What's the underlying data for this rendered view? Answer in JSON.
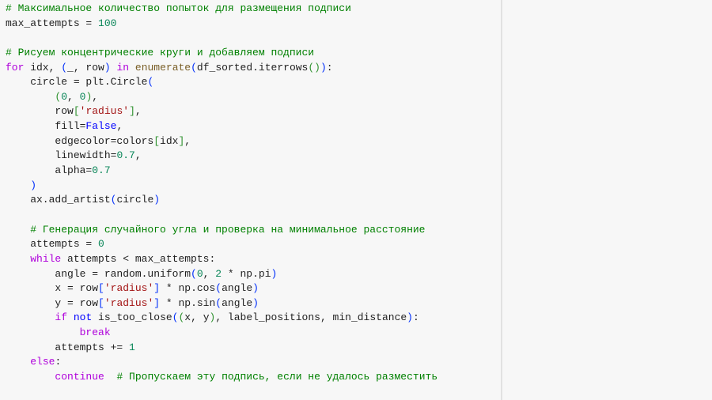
{
  "code_lines": [
    [
      [
        "# Максимальное количество попыток для размещения подписи",
        "c"
      ]
    ],
    [
      [
        "max_attempts = ",
        ""
      ],
      [
        "100",
        "n"
      ]
    ],
    [],
    [
      [
        "# Рисуем концентрические круги и добавляем подписи",
        "c"
      ]
    ],
    [
      [
        "for",
        "k"
      ],
      [
        " idx, ",
        ""
      ],
      [
        "(",
        "b1"
      ],
      [
        "_, row",
        ""
      ],
      [
        ")",
        "b1"
      ],
      [
        " ",
        ""
      ],
      [
        "in",
        "k"
      ],
      [
        " ",
        ""
      ],
      [
        "enumerate",
        "f"
      ],
      [
        "(",
        "b1"
      ],
      [
        "df_sorted.iterrows",
        ""
      ],
      [
        "()",
        "b2"
      ],
      [
        ")",
        "b1"
      ],
      [
        ":",
        ""
      ]
    ],
    [
      [
        "    circle = plt.Circle",
        ""
      ],
      [
        "(",
        "b1"
      ]
    ],
    [
      [
        "        ",
        ""
      ],
      [
        "(",
        "b2"
      ],
      [
        "0",
        "n"
      ],
      [
        ", ",
        ""
      ],
      [
        "0",
        "n"
      ],
      [
        ")",
        "b2"
      ],
      [
        ",",
        ""
      ]
    ],
    [
      [
        "        row",
        ""
      ],
      [
        "[",
        "b2"
      ],
      [
        "'radius'",
        "s"
      ],
      [
        "]",
        "b2"
      ],
      [
        ",",
        ""
      ]
    ],
    [
      [
        "        fill=",
        ""
      ],
      [
        "False",
        "kb"
      ],
      [
        ",",
        ""
      ]
    ],
    [
      [
        "        edgecolor=colors",
        ""
      ],
      [
        "[",
        "b2"
      ],
      [
        "idx",
        ""
      ],
      [
        "]",
        "b2"
      ],
      [
        ",",
        ""
      ]
    ],
    [
      [
        "        linewidth=",
        ""
      ],
      [
        "0.7",
        "n"
      ],
      [
        ",",
        ""
      ]
    ],
    [
      [
        "        alpha=",
        ""
      ],
      [
        "0.7",
        "n"
      ]
    ],
    [
      [
        "    ",
        ""
      ],
      [
        ")",
        "b1"
      ]
    ],
    [
      [
        "    ax.add_artist",
        ""
      ],
      [
        "(",
        "b1"
      ],
      [
        "circle",
        ""
      ],
      [
        ")",
        "b1"
      ]
    ],
    [],
    [
      [
        "    # Генерация случайного угла и проверка на минимальное расстояние",
        "c"
      ]
    ],
    [
      [
        "    attempts = ",
        ""
      ],
      [
        "0",
        "n"
      ]
    ],
    [
      [
        "    ",
        ""
      ],
      [
        "while",
        "k"
      ],
      [
        " attempts < max_attempts:",
        ""
      ]
    ],
    [
      [
        "        angle = random.uniform",
        ""
      ],
      [
        "(",
        "b1"
      ],
      [
        "0",
        "n"
      ],
      [
        ", ",
        ""
      ],
      [
        "2",
        "n"
      ],
      [
        " * np.pi",
        ""
      ],
      [
        ")",
        "b1"
      ]
    ],
    [
      [
        "        x = row",
        ""
      ],
      [
        "[",
        "b1"
      ],
      [
        "'radius'",
        "s"
      ],
      [
        "]",
        "b1"
      ],
      [
        " * np.cos",
        ""
      ],
      [
        "(",
        "b1"
      ],
      [
        "angle",
        ""
      ],
      [
        ")",
        "b1"
      ]
    ],
    [
      [
        "        y = row",
        ""
      ],
      [
        "[",
        "b1"
      ],
      [
        "'radius'",
        "s"
      ],
      [
        "]",
        "b1"
      ],
      [
        " * np.sin",
        ""
      ],
      [
        "(",
        "b1"
      ],
      [
        "angle",
        ""
      ],
      [
        ")",
        "b1"
      ]
    ],
    [
      [
        "        ",
        ""
      ],
      [
        "if",
        "k"
      ],
      [
        " ",
        ""
      ],
      [
        "not",
        "kb"
      ],
      [
        " is_too_close",
        ""
      ],
      [
        "(",
        "b1"
      ],
      [
        "(",
        "b2"
      ],
      [
        "x, y",
        ""
      ],
      [
        ")",
        "b2"
      ],
      [
        ", label_positions, min_distance",
        ""
      ],
      [
        ")",
        "b1"
      ],
      [
        ":",
        ""
      ]
    ],
    [
      [
        "            ",
        ""
      ],
      [
        "break",
        "k"
      ]
    ],
    [
      [
        "        attempts += ",
        ""
      ],
      [
        "1",
        "n"
      ]
    ],
    [
      [
        "    ",
        ""
      ],
      [
        "else",
        "k"
      ],
      [
        ":",
        ""
      ]
    ],
    [
      [
        "        ",
        ""
      ],
      [
        "continue",
        "k"
      ],
      [
        "  ",
        ""
      ],
      [
        "# Пропускаем эту подпись, если не удалось разместить",
        "c"
      ]
    ]
  ]
}
